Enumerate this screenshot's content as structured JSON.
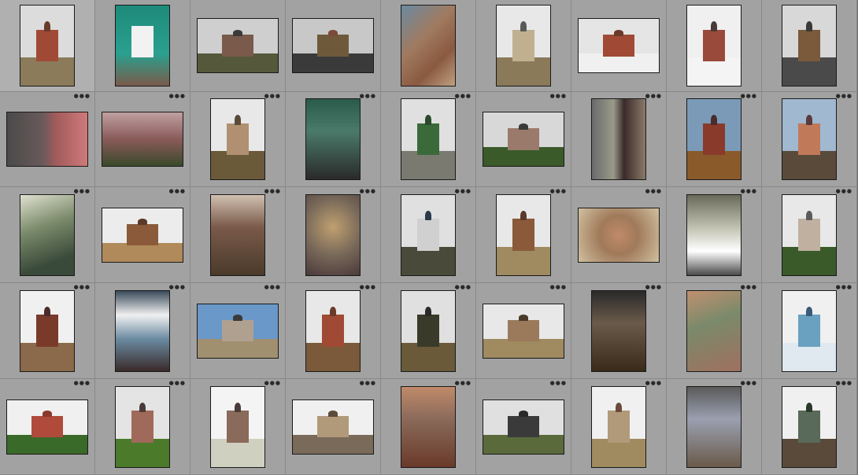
{
  "grid": {
    "columns": 9,
    "rows": 5,
    "cells": [
      {
        "o": "p",
        "sky": "#dcdcdc",
        "ground": "#8b7b5a",
        "bldg": "#a04a35",
        "dome": "#6a3a2a",
        "dots": false
      },
      {
        "o": "p",
        "full": "linear-gradient(180deg,#1e8a7a 0%,#2aa08e 60%,#7a5a4a 100%)",
        "bldg": "#f2f2f2",
        "dots": false
      },
      {
        "o": "l",
        "sky": "#cfcfcf",
        "ground": "#55583a",
        "bldg": "#7a5a4a",
        "dome": "#3a3a3a",
        "dots": false
      },
      {
        "o": "l",
        "sky": "#c8c8c8",
        "ground": "#3a3a3a",
        "bldg": "#6e5a3a",
        "dome": "#7a4a3a",
        "dots": false
      },
      {
        "o": "p",
        "full": "linear-gradient(135deg,#6a8aa0,#a07a60 40%,#8a5a40 70%,#c0a080)",
        "dots": false
      },
      {
        "o": "p",
        "sky": "#e8e8e8",
        "ground": "#8a7a5a",
        "bldg": "#c0b090",
        "dome": "#5a5a5a",
        "dots": false
      },
      {
        "o": "l",
        "sky": "#e5e5e5",
        "ground": "#f0f0f0",
        "bldg": "#a04a35",
        "dome": "#6a3a2a",
        "dots": false
      },
      {
        "o": "p",
        "sky": "#f0f0f0",
        "ground": "#f4f4f4",
        "bldg": "#9a4a3a",
        "dome": "#4a3a3a",
        "dots": false
      },
      {
        "o": "p",
        "sky": "#d8d8d8",
        "ground": "#4a4a4a",
        "bldg": "#7a5a3a",
        "dome": "#3a3a3a",
        "dots": false
      },
      {
        "o": "l",
        "full": "linear-gradient(90deg,#4a4a4a,#6a5a5a 45%,#a05a5a 60%,#d07a7a)",
        "dots": true
      },
      {
        "o": "l",
        "full": "linear-gradient(180deg,#c0a0a0,#8a5a5a 50%,#3a4a2a)",
        "dots": true
      },
      {
        "o": "p",
        "sky": "#e8e8e8",
        "ground": "#6a5a3a",
        "bldg": "#b09070",
        "dome": "#5a4a3a",
        "dots": true
      },
      {
        "o": "p",
        "full": "linear-gradient(180deg,#2a5a4a,#4a7a6a 40%,#2a2a2a)",
        "dots": true
      },
      {
        "o": "p",
        "sky": "#e0e0e0",
        "ground": "#7a7a70",
        "bldg": "#3a6a3a",
        "dome": "#2a4a2a",
        "dots": true
      },
      {
        "o": "l",
        "sky": "#d8d8d8",
        "ground": "#3a5a2a",
        "bldg": "#9a7a6a",
        "dome": "#3a3a3a",
        "dots": true
      },
      {
        "o": "p",
        "full": "linear-gradient(90deg,#6a6a6a,#9a9a8a 40%,#3a2a2a 60%,#8a7a6a)",
        "dots": true
      },
      {
        "o": "p",
        "sky": "#7a9ab8",
        "ground": "#8a5a2a",
        "bldg": "#8a3a2a",
        "dome": "#4a2a2a",
        "dots": true
      },
      {
        "o": "p",
        "sky": "#a0b8d0",
        "ground": "#5a4a3a",
        "bldg": "#c07a5a",
        "dome": "#5a3a3a",
        "dots": true
      },
      {
        "o": "p",
        "full": "linear-gradient(160deg,#e0e0d0,#7a8a6a 40%,#3a4a3a 80%)",
        "dots": true
      },
      {
        "o": "l",
        "sky": "#ececec",
        "ground": "#b08a5a",
        "bldg": "#8a5a3a",
        "dome": "#5a3a2a",
        "dots": true
      },
      {
        "o": "p",
        "full": "linear-gradient(180deg,#d0c0b0,#7a5a4a 40%,#4a3a2a)",
        "dots": true
      },
      {
        "o": "p",
        "full": "radial-gradient(circle at 50% 40%,#c0a070,#7a6a5a 50%,#4a3a3a)",
        "dots": true
      },
      {
        "o": "p",
        "sky": "#e0e0e0",
        "ground": "#4a4a3a",
        "bldg": "#d0d0d0",
        "dome": "#2a3a4a",
        "dots": true
      },
      {
        "o": "p",
        "sky": "#e8e8e8",
        "ground": "#a08a60",
        "bldg": "#8a5a3a",
        "dome": "#5a3a2a",
        "dots": true
      },
      {
        "o": "l",
        "full": "radial-gradient(circle at 50% 50%,#c08a6a,#a07a5a 40%,#d0c0a0)",
        "dots": true
      },
      {
        "o": "p",
        "full": "linear-gradient(180deg,#6a6a5a,#c0c0b0 40%,#ffffff 70%,#4a4a4a)",
        "dots": true
      },
      {
        "o": "p",
        "sky": "#e8e8e8",
        "ground": "#3a5a2a",
        "bldg": "#c0b0a0",
        "dome": "#5a5a5a",
        "dots": true
      },
      {
        "o": "p",
        "sky": "#f0f0f0",
        "ground": "#8a6a4a",
        "bldg": "#7a3a2a",
        "dome": "#4a2a2a",
        "dots": true
      },
      {
        "o": "p",
        "full": "linear-gradient(180deg,#3a4a5a,#f0f0f0 30%,#6a8aa0 60%,#3a2a2a)",
        "dots": true
      },
      {
        "o": "l",
        "sky": "#6a98c8",
        "ground": "#a09070",
        "bldg": "#b0a090",
        "dome": "#3a3a3a",
        "dots": true
      },
      {
        "o": "p",
        "sky": "#e8e8e8",
        "ground": "#7a5a3a",
        "bldg": "#a04a35",
        "dome": "#6a3a2a",
        "dots": true
      },
      {
        "o": "p",
        "sky": "#e0e0e0",
        "ground": "#6a5a3a",
        "bldg": "#3a3a2a",
        "dome": "#2a2a2a",
        "dots": true
      },
      {
        "o": "l",
        "sky": "#e8e8e8",
        "ground": "#a08a60",
        "bldg": "#9a7a5a",
        "dome": "#4a3a2a",
        "dots": true
      },
      {
        "o": "p",
        "full": "linear-gradient(180deg,#2a2a2a,#6a5a4a 40%,#3a2a1a)",
        "dots": true
      },
      {
        "o": "p",
        "full": "linear-gradient(160deg,#c09070,#7a8a6a 40%,#a07060)",
        "dots": true
      },
      {
        "o": "p",
        "sky": "#f0f0f0",
        "ground": "#e0e8f0",
        "bldg": "#6aa0c0",
        "dome": "#3a5a7a",
        "dots": true
      },
      {
        "o": "l",
        "sky": "#f0f0f0",
        "ground": "#3a6a2a",
        "bldg": "#b04a3a",
        "dome": "#8a3a2a",
        "dots": true
      },
      {
        "o": "p",
        "sky": "#e4e4e4",
        "ground": "#4a7a2a",
        "bldg": "#a06a5a",
        "dome": "#4a3a3a",
        "dots": true
      },
      {
        "o": "p",
        "sky": "#f4f4f4",
        "ground": "#d0d0c0",
        "bldg": "#8a6a5a",
        "dome": "#4a3a3a",
        "dots": true
      },
      {
        "o": "l",
        "sky": "#f0f0f0",
        "ground": "#7a6a5a",
        "bldg": "#b09a7a",
        "dome": "#5a4a3a",
        "dots": true
      },
      {
        "o": "p",
        "full": "linear-gradient(180deg,#c08a6a,#8a6a5a 40%,#6a3a2a)",
        "dots": true
      },
      {
        "o": "l",
        "sky": "#e0e0e0",
        "ground": "#5a6a3a",
        "bldg": "#3a3a3a",
        "dome": "#2a2a2a",
        "dots": true
      },
      {
        "o": "p",
        "sky": "#f0f0f0",
        "ground": "#a08a60",
        "bldg": "#b09a7a",
        "dome": "#6a4a3a",
        "dots": true
      },
      {
        "o": "p",
        "full": "linear-gradient(180deg,#5a5a5a,#9aa0b0 40%,#6a5a4a)",
        "dots": true
      },
      {
        "o": "p",
        "sky": "#f0f0f0",
        "ground": "#5a4a3a",
        "bldg": "#5a6a5a",
        "dome": "#2a3a2a",
        "dots": true
      }
    ]
  }
}
